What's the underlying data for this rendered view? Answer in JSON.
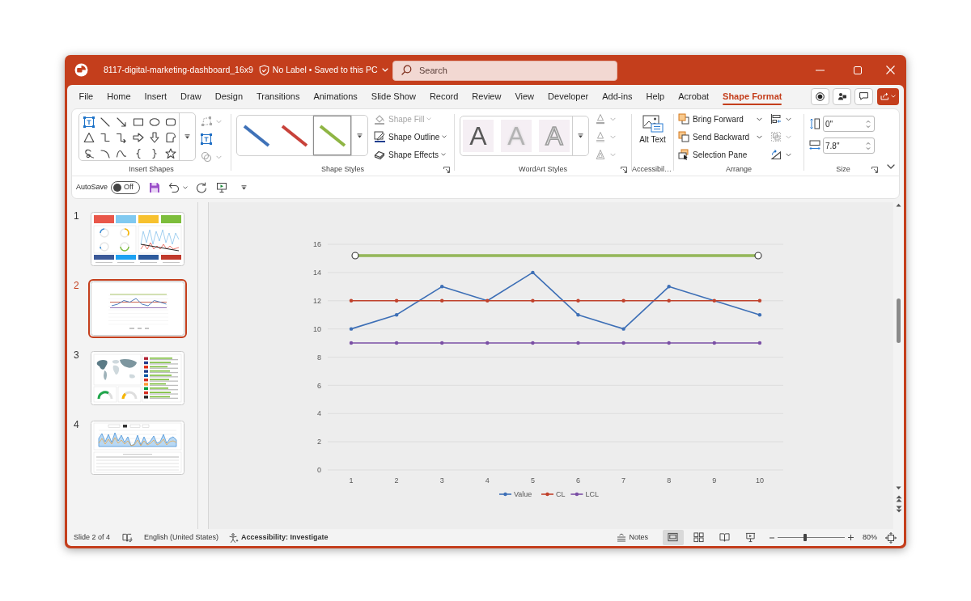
{
  "window": {
    "title": "8117-digital-marketing-dashboard_16x9",
    "status": "No Label • Saved to this PC"
  },
  "search": {
    "placeholder": "Search"
  },
  "tabs": [
    {
      "label": "File",
      "selected": false
    },
    {
      "label": "Home",
      "selected": false
    },
    {
      "label": "Insert",
      "selected": false
    },
    {
      "label": "Draw",
      "selected": false
    },
    {
      "label": "Design",
      "selected": false
    },
    {
      "label": "Transitions",
      "selected": false
    },
    {
      "label": "Animations",
      "selected": false
    },
    {
      "label": "Slide Show",
      "selected": false
    },
    {
      "label": "Record",
      "selected": false
    },
    {
      "label": "Review",
      "selected": false
    },
    {
      "label": "View",
      "selected": false
    },
    {
      "label": "Developer",
      "selected": false
    },
    {
      "label": "Add-ins",
      "selected": false
    },
    {
      "label": "Help",
      "selected": false
    },
    {
      "label": "Acrobat",
      "selected": false
    },
    {
      "label": "Shape Format",
      "selected": true
    }
  ],
  "ribbon": {
    "insert_shapes": {
      "label": "Insert Shapes",
      "tools": [
        {
          "kind": "edit_shape",
          "disabled": true
        },
        {
          "kind": "text_box",
          "disabled": false
        },
        {
          "kind": "merge_shapes",
          "disabled": true
        }
      ]
    },
    "shape_styles": {
      "label": "Shape Styles",
      "styles": [
        {
          "color": "#3f72b8",
          "selected": false
        },
        {
          "color": "#c8423a",
          "selected": false
        },
        {
          "color": "#8fb544",
          "selected": true
        }
      ],
      "buttons": [
        {
          "kind": "fill",
          "label": "Shape Fill",
          "disabled": true
        },
        {
          "kind": "outline",
          "label": "Shape Outline",
          "disabled": false
        },
        {
          "kind": "effects",
          "label": "Shape Effects",
          "disabled": false
        }
      ]
    },
    "wordart_styles": {
      "label": "WordArt Styles",
      "styles": [
        {
          "kind": "solid",
          "sample": "A"
        },
        {
          "kind": "soft",
          "sample": "A"
        },
        {
          "kind": "outline",
          "sample": "A"
        }
      ],
      "tools": [
        {
          "kind": "text_fill",
          "disabled": true
        },
        {
          "kind": "text_outline",
          "disabled": true
        },
        {
          "kind": "text_effects",
          "disabled": true
        }
      ]
    },
    "accessibility": {
      "label": "Accessibil…",
      "alt_text": "Alt Text"
    },
    "arrange": {
      "label": "Arrange",
      "buttons": [
        {
          "kind": "bring_forward",
          "label": "Bring Forward"
        },
        {
          "kind": "send_backward",
          "label": "Send Backward"
        },
        {
          "kind": "selection_pane",
          "label": "Selection Pane"
        }
      ],
      "tools": [
        {
          "kind": "align",
          "disabled": false
        },
        {
          "kind": "group",
          "disabled": true
        },
        {
          "kind": "rotate",
          "disabled": false
        }
      ]
    },
    "size": {
      "label": "Size",
      "fields": [
        {
          "kind": "height",
          "value": "0\""
        },
        {
          "kind": "width",
          "value": "7.8\""
        }
      ]
    }
  },
  "quick_access": {
    "autosave": {
      "label": "AutoSave",
      "on": false,
      "state": "Off"
    }
  },
  "slides": [
    {
      "number": "1",
      "kind": "dashboard",
      "selected": false
    },
    {
      "number": "2",
      "kind": "chart",
      "selected": true
    },
    {
      "number": "3",
      "kind": "map",
      "selected": false
    },
    {
      "number": "4",
      "kind": "report",
      "selected": false
    }
  ],
  "slide": {
    "chart_data": {
      "type": "line",
      "categories": [
        "1",
        "2",
        "3",
        "4",
        "5",
        "6",
        "7",
        "8",
        "9",
        "10"
      ],
      "series": [
        {
          "name": "Value",
          "color": "#3d6fb6",
          "values": [
            10,
            11,
            13,
            12,
            14,
            11,
            10,
            13,
            12,
            11
          ]
        },
        {
          "name": "CL",
          "color": "#c0412b",
          "values": [
            12,
            12,
            12,
            12,
            12,
            12,
            12,
            12,
            12,
            12
          ]
        },
        {
          "name": "LCL",
          "color": "#7a4fa5",
          "values": [
            9,
            9,
            9,
            9,
            9,
            9,
            9,
            9,
            9,
            9
          ]
        }
      ],
      "ylim": [
        0,
        16
      ],
      "yticks": [
        0,
        2,
        4,
        6,
        8,
        10,
        12,
        14,
        16
      ],
      "grid": true,
      "legend": "bottom"
    },
    "shapes": [
      {
        "kind": "line",
        "selected": true
      }
    ]
  },
  "status_bar": {
    "slide_info": "Slide 2 of 4",
    "language": "English (United States)",
    "accessibility": "Accessibility: Investigate",
    "notes": "Notes",
    "views": [
      {
        "kind": "normal",
        "selected": true
      },
      {
        "kind": "sorter",
        "selected": false
      },
      {
        "kind": "reading",
        "selected": false
      },
      {
        "kind": "slideshow",
        "selected": false
      }
    ],
    "zoom": {
      "level": 0.41,
      "reading": "80%"
    }
  }
}
